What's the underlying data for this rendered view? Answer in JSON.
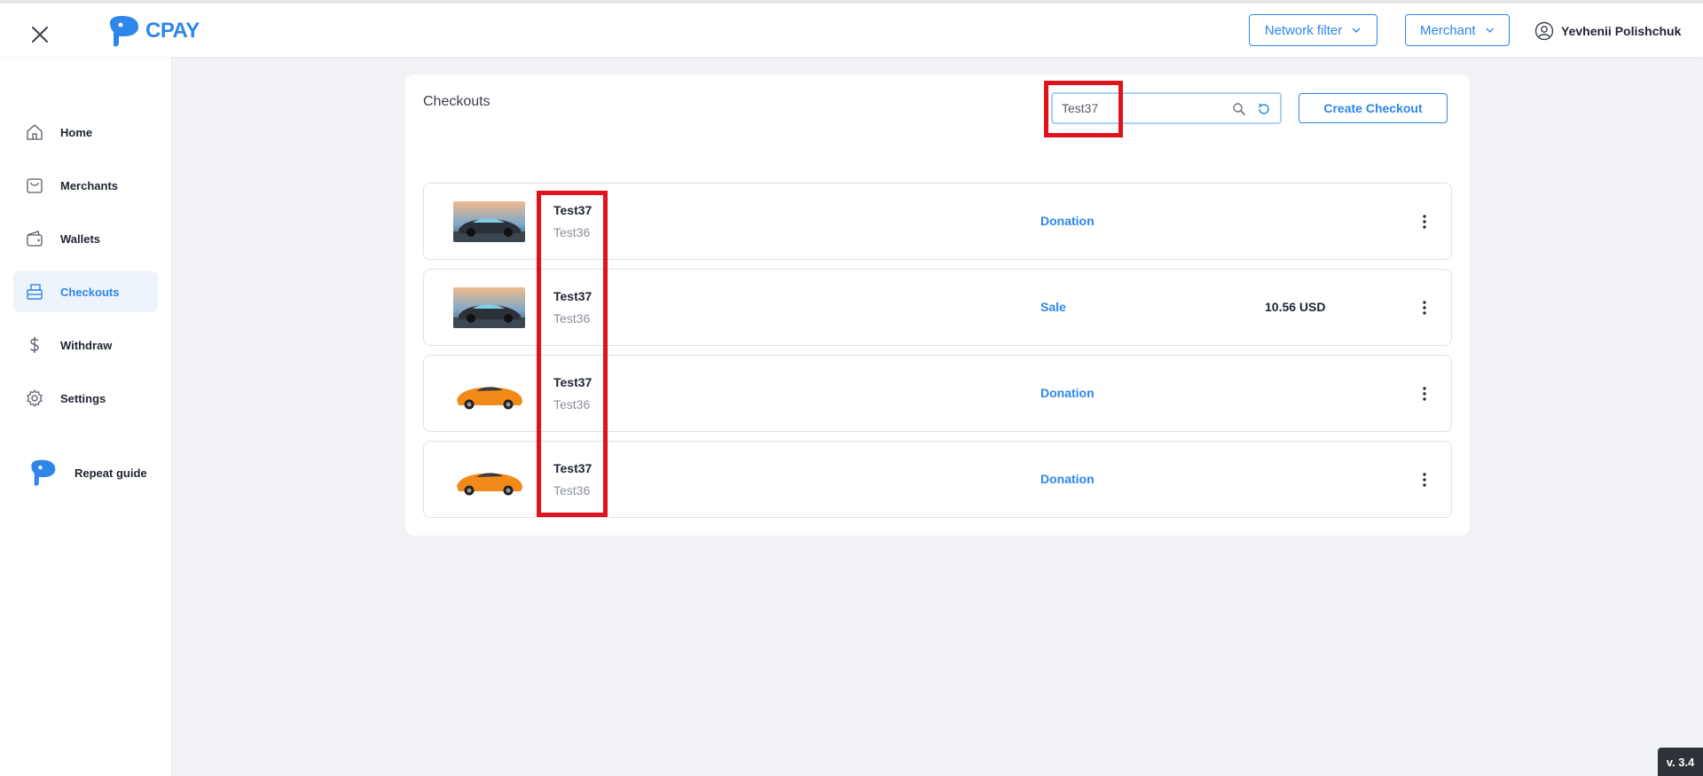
{
  "app": {
    "brand": "CPAY",
    "version": "v. 3.4"
  },
  "header": {
    "network_filter_label": "Network filter",
    "merchant_label": "Merchant",
    "user_name": "Yevhenii Polishchuk"
  },
  "sidebar": {
    "items": [
      {
        "label": "Home",
        "icon": "home-icon",
        "active": false
      },
      {
        "label": "Merchants",
        "icon": "shopping-bag-icon",
        "active": false
      },
      {
        "label": "Wallets",
        "icon": "wallet-icon",
        "active": false
      },
      {
        "label": "Checkouts",
        "icon": "checkout-register-icon",
        "active": true
      },
      {
        "label": "Withdraw",
        "icon": "dollar-icon",
        "active": false
      },
      {
        "label": "Settings",
        "icon": "gear-icon",
        "active": false
      }
    ],
    "repeat_guide_label": "Repeat guide"
  },
  "main": {
    "title": "Checkouts",
    "search": {
      "value": "Test37",
      "placeholder": ""
    },
    "create_button_label": "Create Checkout",
    "checkouts": [
      {
        "title": "Test37",
        "subtitle": "Test36",
        "type": "Donation",
        "amount": "",
        "image": "dark-sports-car"
      },
      {
        "title": "Test37",
        "subtitle": "Test36",
        "type": "Sale",
        "amount": "10.56 USD",
        "image": "dark-sports-car"
      },
      {
        "title": "Test37",
        "subtitle": "Test36",
        "type": "Donation",
        "amount": "",
        "image": "orange-sports-car"
      },
      {
        "title": "Test37",
        "subtitle": "Test36",
        "type": "Donation",
        "amount": "",
        "image": "orange-sports-car"
      }
    ]
  },
  "colors": {
    "accent": "#2d86ea",
    "highlight": "#e0121b",
    "background": "#f0f2f5"
  }
}
